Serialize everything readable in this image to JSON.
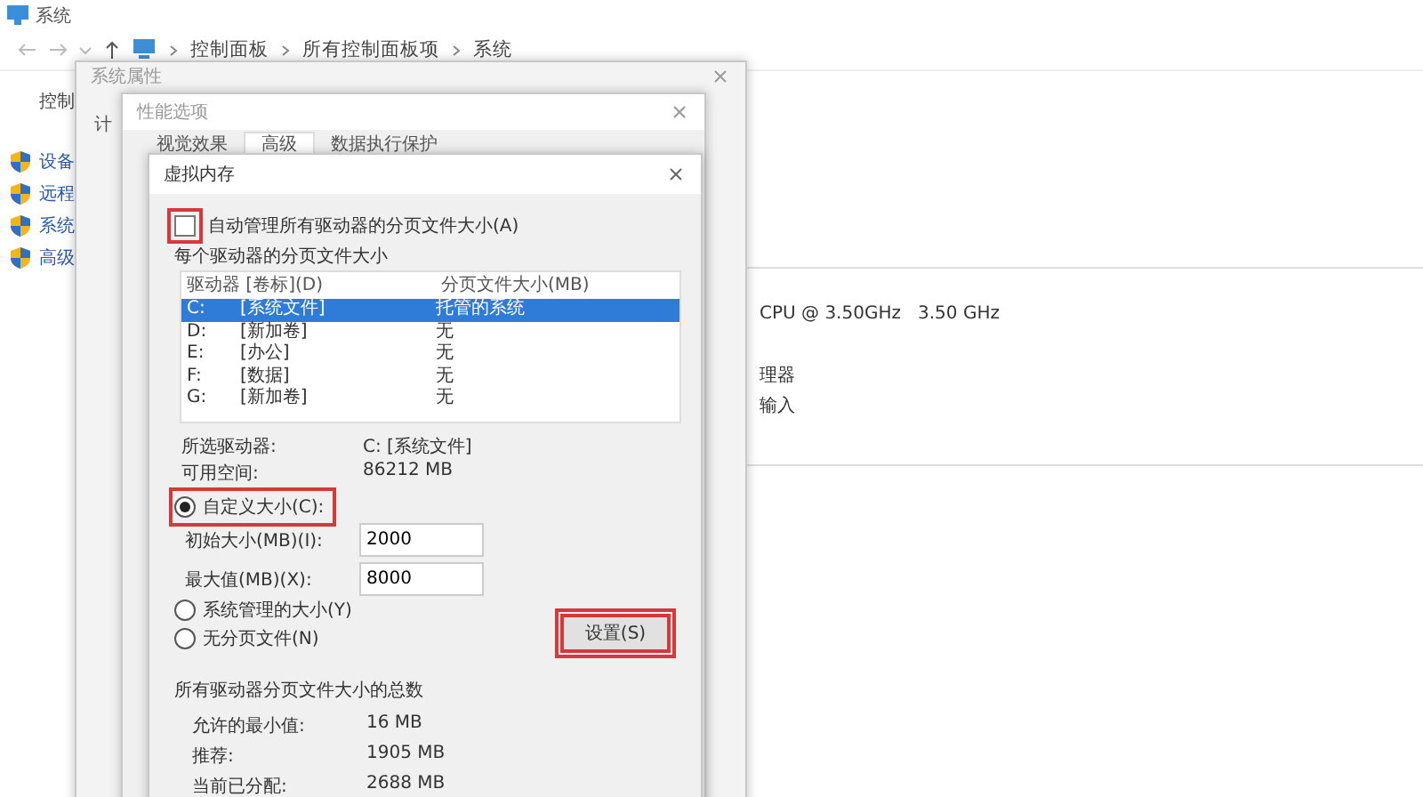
{
  "system_window": {
    "title": "系统",
    "breadcrumb": [
      "控制面板",
      "所有控制面板项",
      "系统"
    ],
    "nav_heading": "控制",
    "nav_items": [
      "设备",
      "远程",
      "系统",
      "高级"
    ],
    "info_lines": [
      "CPU @ 3.50GHz   3.50 GHz",
      "理器",
      "输入"
    ]
  },
  "system_properties": {
    "title": "系统属性",
    "fragments": [
      "计"
    ]
  },
  "performance_options": {
    "title": "性能选项",
    "tabs": [
      {
        "label": "视觉效果",
        "selected": false
      },
      {
        "label": "高级",
        "selected": true
      },
      {
        "label": "数据执行保护",
        "selected": false
      }
    ]
  },
  "virtual_memory": {
    "title": "虚拟内存",
    "auto_manage": {
      "label": "自动管理所有驱动器的分页文件大小(A)",
      "checked": false,
      "highlighted": true
    },
    "per_drive_heading": "每个驱动器的分页文件大小",
    "drive_list": {
      "columns": [
        "驱动器 [卷标](D)",
        "分页文件大小(MB)"
      ],
      "rows": [
        {
          "drive": "C:",
          "volume": "[系统文件]",
          "size": "托管的系统",
          "selected": true
        },
        {
          "drive": "D:",
          "volume": "[新加卷]",
          "size": "无",
          "selected": false
        },
        {
          "drive": "E:",
          "volume": "[办公]",
          "size": "无",
          "selected": false
        },
        {
          "drive": "F:",
          "volume": "[数据]",
          "size": "无",
          "selected": false
        },
        {
          "drive": "G:",
          "volume": "[新加卷]",
          "size": "无",
          "selected": false
        }
      ]
    },
    "drive_info": [
      {
        "label": "所选驱动器:",
        "value": "C:  [系统文件]"
      },
      {
        "label": "可用空间:",
        "value": "86212 MB"
      }
    ],
    "size_options": [
      {
        "label": "自定义大小(C):",
        "selected": true,
        "highlighted": true
      },
      {
        "label": "系统管理的大小(Y)",
        "selected": false,
        "highlighted": false
      },
      {
        "label": "无分页文件(N)",
        "selected": false,
        "highlighted": false
      }
    ],
    "fields": [
      {
        "label": "初始大小(MB)(I):",
        "value": "2000"
      },
      {
        "label": "最大值(MB)(X):",
        "value": "8000"
      }
    ],
    "set_button": {
      "label": "设置(S)",
      "highlighted": true
    },
    "totals_heading": "所有驱动器分页文件大小的总数",
    "totals": [
      {
        "label": "允许的最小值:",
        "value": "16 MB"
      },
      {
        "label": "推荐:",
        "value": "1905 MB"
      },
      {
        "label": "当前已分配:",
        "value": "2688 MB"
      }
    ]
  }
}
